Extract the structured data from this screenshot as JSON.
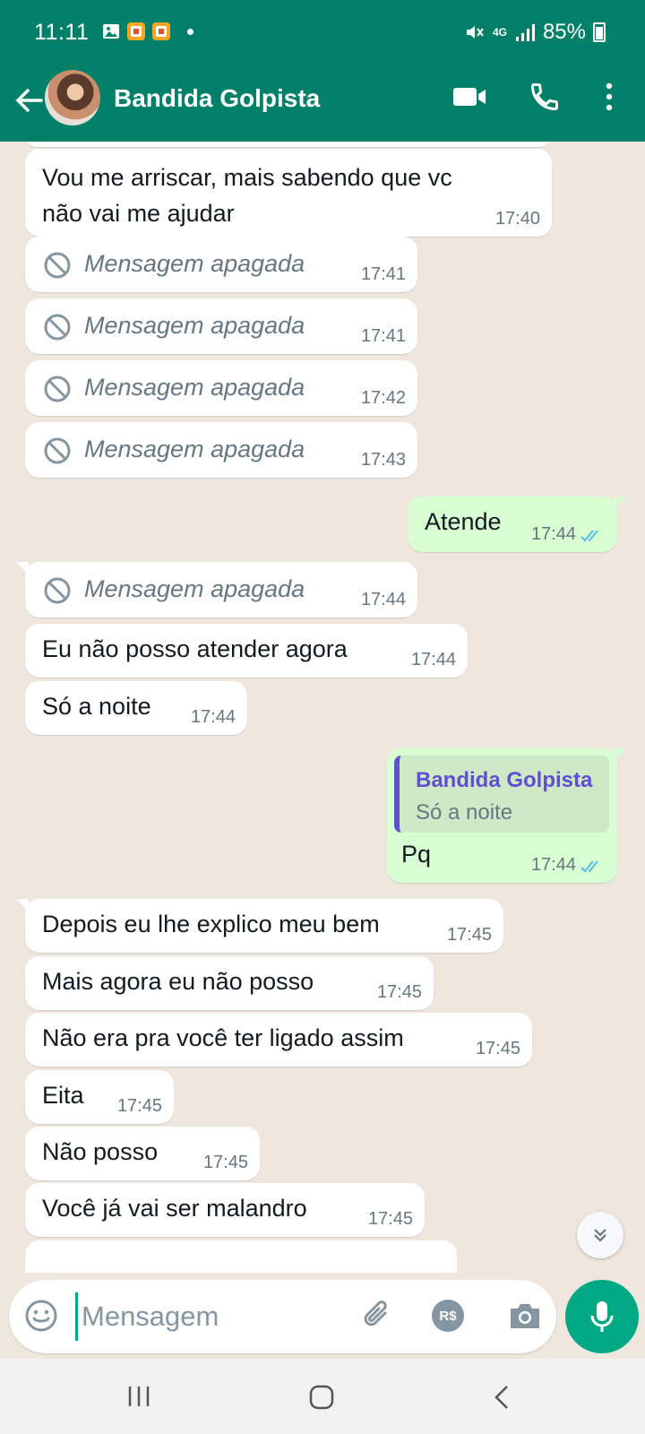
{
  "status_bar": {
    "time": "11:11",
    "network": "4G",
    "battery": "85%"
  },
  "header": {
    "contact_name": "Bandida Golpista",
    "icons": [
      "back-arrow-icon",
      "video-call-icon",
      "voice-call-icon",
      "more-options-icon"
    ]
  },
  "messages": [
    {
      "type": "incoming",
      "text_lines": [
        "Vou me arriscar,  mais sabendo que vc",
        "não vai me ajudar"
      ],
      "time": "17:40"
    },
    {
      "type": "deleted",
      "text": "Mensagem apagada",
      "time": "17:41"
    },
    {
      "type": "deleted",
      "text": "Mensagem apagada",
      "time": "17:41"
    },
    {
      "type": "deleted",
      "text": "Mensagem apagada",
      "time": "17:42"
    },
    {
      "type": "deleted",
      "text": "Mensagem apagada",
      "time": "17:43"
    },
    {
      "type": "outgoing",
      "text": "Atende",
      "time": "17:44",
      "status": "read"
    },
    {
      "type": "deleted",
      "text": "Mensagem apagada",
      "time": "17:44"
    },
    {
      "type": "incoming",
      "text": "Eu não posso atender agora",
      "time": "17:44"
    },
    {
      "type": "incoming",
      "text": "Só a noite",
      "time": "17:44"
    },
    {
      "type": "outgoing",
      "quote_author": "Bandida Golpista",
      "quote_text": "Só a noite",
      "text": "Pq",
      "time": "17:44",
      "status": "read"
    },
    {
      "type": "incoming",
      "text": "Depois eu lhe explico meu bem",
      "time": "17:45"
    },
    {
      "type": "incoming",
      "text": "Mais agora eu não posso",
      "time": "17:45"
    },
    {
      "type": "incoming",
      "text": "Não era pra você ter ligado assim",
      "time": "17:45"
    },
    {
      "type": "incoming",
      "text": "Eita",
      "time": "17:45"
    },
    {
      "type": "incoming",
      "text": "Não posso",
      "time": "17:45"
    },
    {
      "type": "incoming",
      "text": "Você já vai ser malandro",
      "time": "17:45"
    }
  ],
  "composer": {
    "placeholder": "Mensagem",
    "pay_label": "R$"
  },
  "colors": {
    "header": "#008069",
    "chat_background": "#efe7de",
    "incoming_bubble": "#ffffff",
    "outgoing_bubble": "#d9fdd3",
    "read_ticks": "#53bdeb",
    "accent": "#00a884",
    "quote_bar": "#5e4fd3"
  }
}
